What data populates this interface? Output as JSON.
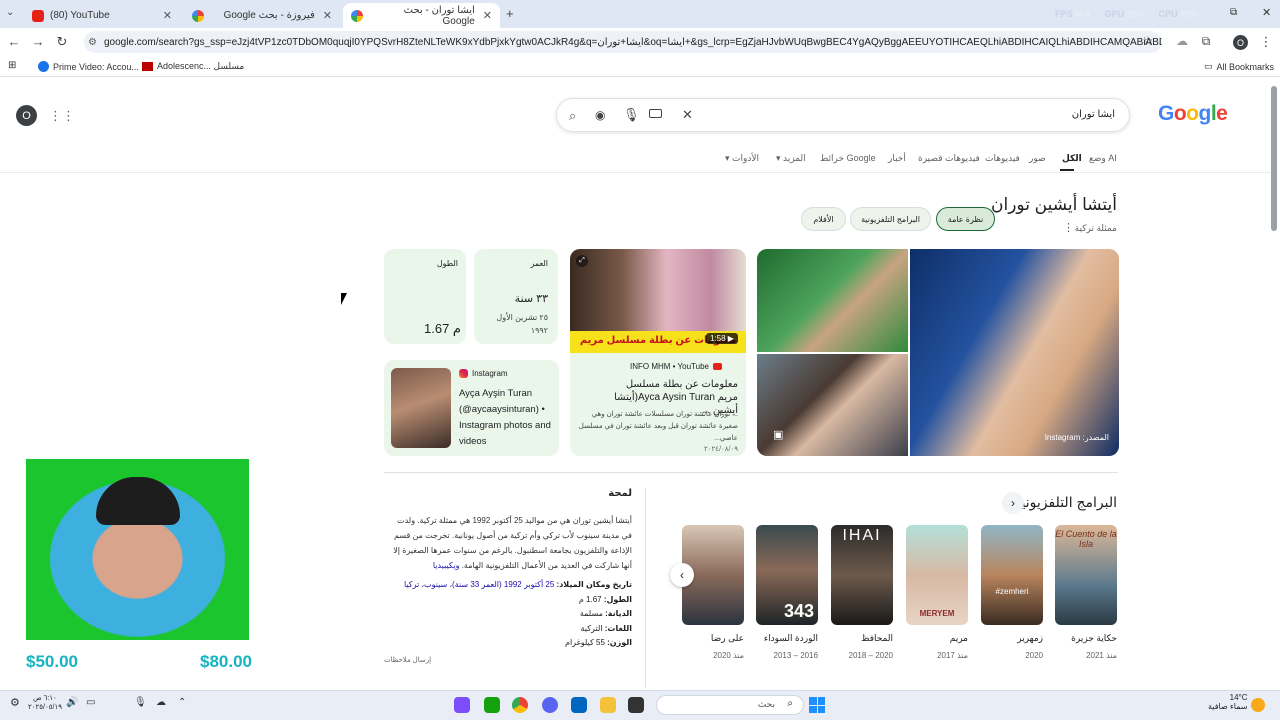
{
  "browser": {
    "tabs": [
      {
        "title": "(80) YouTube"
      },
      {
        "title": "فيروزة - بحث Google"
      },
      {
        "title": "ايشا توران - بحث Google"
      }
    ],
    "url": "google.com/search?gs_ssp=eJzj4tVP1zc0TDbOM0quqjI0YPQSvrH8ZteNLTeWK9xYdbPjxkYgtw0ACJkR4g&q=ايشا+توران&oq=ايشا+&gs_lcrp=EgZjaHJvbWUqBwgBEC4YgAQyBggAEEUYOTIHCAEQLhiABDIHCAIQLhiABDIHCAMQABiABDIHCAQQLhiABDIH",
    "bookmarks": [
      {
        "label": "Prime Video: Accou..."
      },
      {
        "label": "Adolescenc... مسلسل"
      }
    ],
    "all_bookmarks": "All Bookmarks",
    "perf": {
      "fps_label": "FPS",
      "fps": "N/A",
      "gpu_label": "GPU",
      "gpu": "26%",
      "cpu_label": "CPU",
      "cpu": "42%"
    },
    "profile_letter": "O"
  },
  "search": {
    "query": "ايشا توران",
    "logo": "Google",
    "profile_letter": "O"
  },
  "nav": [
    "وضع AI",
    "الكل",
    "صور",
    "فيديوهات",
    "فيديوهات قصيرة",
    "أخبار",
    "خرائط Google",
    "المزيد",
    "الأدوات"
  ],
  "entity": {
    "name": "أيتشا أيشين توران",
    "subtitle": "ممثلة تركية",
    "chips": [
      "نظرة عامة",
      "البرامج التلفزيونية",
      "الأفلام"
    ]
  },
  "facts": {
    "age_label": "العمر",
    "age": "٣٣ سنة",
    "birth": "٢٥ تشرين الأول ١٩٩٢",
    "height_label": "الطول",
    "height": "1.67 م"
  },
  "video": {
    "overlay": "معلومات عن بطلة مسلسل مريم",
    "duration": "1:58 ▶",
    "source": "INFO MHM • YouTube",
    "title": "معلومات عن بطلة مسلسل مريم Ayca Aysin Turan(أيتشا أيشين ...",
    "snippet": "... توران عائشة توران مسلسلات عائشة توران وهي صغيرة عائشة توران قبل وبعد عائشة توران في مسلسل عاصي...",
    "date": "٢٠٢٤/٠٨/٠٩"
  },
  "instagram": {
    "source": "Instagram",
    "text": "Ayça Ayşin Turan (@aycaaysinturan) • Instagram photos and videos"
  },
  "image_credit": "المصدر: Instagram",
  "tv": {
    "title": "البرامج التلفزيونية",
    "shows": [
      {
        "name": "حكاية جزيرة",
        "years": "منذ 2021",
        "poster": "El Cuento de la Isla"
      },
      {
        "name": "زمهرير",
        "years": "2020",
        "poster": "#zemheri"
      },
      {
        "name": "مريم",
        "years": "منذ 2017",
        "poster": "MERYEM"
      },
      {
        "name": "المحافظ",
        "years": "2018 – 2020",
        "poster": "IHAI"
      },
      {
        "name": "الوردة السوداء",
        "years": "2013 – 2016",
        "poster": "343"
      },
      {
        "name": "على رضا",
        "years": "منذ 2020",
        "poster": ""
      }
    ]
  },
  "overview": {
    "title": "لمحة",
    "text": "أيتشا أيشين توران هي من مواليد 25 أكتوبر 1992 هي ممثلة تركية. ولدت في مدينة سينوب لأب تركي وأم تركية من أصول يونانية. تخرجت من قسم الإذاعة والتلفزيون بجامعة اسطنبول. بالرغم من سنوات عمرها الصغيرة إلا أنها شاركت في العديد من الأعمال التلفزيونية الهامة.",
    "wiki": "ويكيبيديا",
    "facts": [
      {
        "label": "تاريخ ومكان الميلاد:",
        "value": "25 أكتوبر 1992 (العمر 33 سنة)، سينوب، تركيا"
      },
      {
        "label": "الطول:",
        "value": "1.67 م"
      },
      {
        "label": "الديانة:",
        "value": "مسلمة"
      },
      {
        "label": "اللغات:",
        "value": "التركية"
      },
      {
        "label": "الوزن:",
        "value": "55 كيلوغرام"
      }
    ],
    "feedback": "إرسال ملاحظات"
  },
  "overlay": {
    "price_left": "$50.00",
    "price_right": "$80.00"
  },
  "taskbar": {
    "search": "بحث",
    "weather_temp": "14°C",
    "weather_desc": "سماء صافية",
    "time": "٦:١٠ ص",
    "date": "٢٠٢٥/٠٥/١٩"
  }
}
